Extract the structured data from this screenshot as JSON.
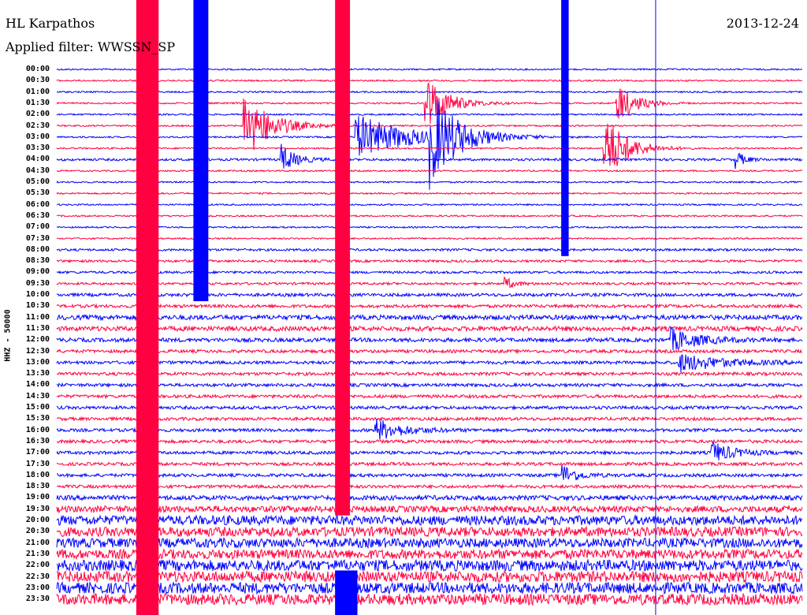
{
  "header": {
    "station": "HL Karpathos",
    "date": "2013-12-24",
    "filter": "Applied filter: WWSSN_SP"
  },
  "chart_data": {
    "type": "line",
    "title": "HL Karpathos 2013-12-24",
    "ylabel": "HHZ - 50000",
    "row_minutes": 30,
    "colors": {
      "even": "#0000ff",
      "odd": "#ff0040"
    },
    "time_labels": [
      "00:00",
      "00:30",
      "01:00",
      "01:30",
      "02:00",
      "02:30",
      "03:00",
      "03:30",
      "04:00",
      "04:30",
      "05:00",
      "05:30",
      "06:00",
      "06:30",
      "07:00",
      "07:30",
      "08:00",
      "08:30",
      "09:00",
      "09:30",
      "10:00",
      "10:30",
      "11:00",
      "11:30",
      "12:00",
      "12:30",
      "13:00",
      "13:30",
      "14:00",
      "14:30",
      "15:00",
      "15:30",
      "16:00",
      "16:30",
      "17:00",
      "17:30",
      "18:00",
      "18:30",
      "19:00",
      "19:30",
      "20:00",
      "20:30",
      "21:00",
      "21:30",
      "22:00",
      "22:30",
      "23:00",
      "23:30"
    ],
    "noise_level_by_row": [
      1,
      1,
      1,
      1,
      1,
      1,
      1,
      1,
      1.5,
      1,
      1,
      1,
      1,
      1,
      1,
      1,
      1.5,
      1.5,
      1.5,
      1.5,
      2,
      2,
      3,
      3,
      2.5,
      2,
      2,
      2,
      2,
      2,
      2,
      2,
      2,
      2,
      2,
      2,
      2,
      2,
      3,
      4,
      6,
      6,
      6,
      6,
      7,
      7,
      7,
      7
    ],
    "saturated_bands": [
      {
        "minute_start": 3.2,
        "minute_end": 4.1,
        "row_start": 0,
        "row_end": 47,
        "color": "#ff0040"
      },
      {
        "minute_start": 5.5,
        "minute_end": 6.1,
        "row_start": 0,
        "row_end": 20,
        "color": "#0000ff"
      },
      {
        "minute_start": 11.2,
        "minute_end": 11.8,
        "row_start": 0,
        "row_end": 39,
        "color": "#ff0040"
      },
      {
        "minute_start": 11.2,
        "minute_end": 12.1,
        "row_start": 45,
        "row_end": 47,
        "color": "#0000ff"
      },
      {
        "minute_start": 20.3,
        "minute_end": 20.6,
        "row_start": 0,
        "row_end": 16,
        "color": "#0000ff"
      }
    ],
    "events": [
      {
        "row": 3,
        "minute": 14.8,
        "amp": 40,
        "dur": 1.2
      },
      {
        "row": 5,
        "minute": 7.5,
        "amp": 45,
        "dur": 1.5
      },
      {
        "row": 6,
        "minute": 12,
        "amp": 30,
        "dur": 3
      },
      {
        "row": 6,
        "minute": 15,
        "amp": 60,
        "dur": 1.5
      },
      {
        "row": 8,
        "minute": 9,
        "amp": 20,
        "dur": 0.8
      },
      {
        "row": 7,
        "minute": 22,
        "amp": 50,
        "dur": 1.2
      },
      {
        "row": 3,
        "minute": 22.5,
        "amp": 30,
        "dur": 1
      },
      {
        "row": 8,
        "minute": 27.3,
        "amp": 12,
        "dur": 0.5
      },
      {
        "row": 32,
        "minute": 12.8,
        "amp": 15,
        "dur": 1.5
      },
      {
        "row": 34,
        "minute": 26.3,
        "amp": 15,
        "dur": 1.2
      },
      {
        "row": 36,
        "minute": 20.3,
        "amp": 15,
        "dur": 0.8
      },
      {
        "row": 24,
        "minute": 24.7,
        "amp": 15,
        "dur": 1.5
      },
      {
        "row": 26,
        "minute": 25,
        "amp": 12,
        "dur": 2.5
      },
      {
        "row": 19,
        "minute": 18,
        "amp": 8,
        "dur": 0.6
      }
    ],
    "vertical_line_minute": 24.1
  }
}
